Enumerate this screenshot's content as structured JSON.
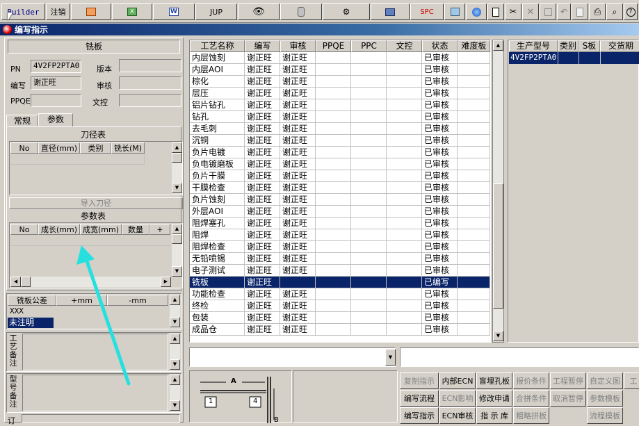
{
  "toolbar": {
    "builder": "Builder",
    "logout": "注销",
    "jup": "JUP",
    "spc": "SPC"
  },
  "window_title": "编写指示",
  "header": {
    "title": "铣板",
    "pn_label": "PN",
    "pn_value": "4V2FP2PTA0",
    "version_label": "版本",
    "version_value": "",
    "writer_label": "编写",
    "writer_value": "谢正旺",
    "review_label": "审核",
    "review_value": "",
    "ppqe_label": "PPQE",
    "ppqe_value": "",
    "doc_label": "文控",
    "doc_value": ""
  },
  "tabs": [
    "常规",
    "参数"
  ],
  "tool_table": {
    "title": "刀径表",
    "columns": [
      "No",
      "直径(mm)",
      "类别",
      "铣长(M)"
    ],
    "import_button": "导入刀径"
  },
  "param_table": {
    "title": "参数表",
    "columns": [
      "No",
      "成长(mm)",
      "成宽(mm)",
      "数量",
      "+"
    ]
  },
  "tolerance": {
    "label": "铣板公差",
    "plus": "+mm",
    "minus": "-mm",
    "value": "XXX",
    "note": "未注明"
  },
  "remarks": {
    "process": "工艺备注",
    "model": "型号备注",
    "bottom": "订"
  },
  "grid": {
    "columns": [
      "工艺名称",
      "编写",
      "审核",
      "PPQE",
      "PPC",
      "文控",
      "状态",
      "难度板"
    ],
    "rows": [
      [
        "内层蚀刻",
        "谢正旺",
        "谢正旺",
        "",
        "",
        "",
        "已审核",
        ""
      ],
      [
        "内层AOI",
        "谢正旺",
        "谢正旺",
        "",
        "",
        "",
        "已审核",
        ""
      ],
      [
        "棕化",
        "谢正旺",
        "谢正旺",
        "",
        "",
        "",
        "已审核",
        ""
      ],
      [
        "层压",
        "谢正旺",
        "谢正旺",
        "",
        "",
        "",
        "已审核",
        ""
      ],
      [
        "铝片钻孔",
        "谢正旺",
        "谢正旺",
        "",
        "",
        "",
        "已审核",
        ""
      ],
      [
        "钻孔",
        "谢正旺",
        "谢正旺",
        "",
        "",
        "",
        "已审核",
        ""
      ],
      [
        "去毛刺",
        "谢正旺",
        "谢正旺",
        "",
        "",
        "",
        "已审核",
        ""
      ],
      [
        "沉铜",
        "谢正旺",
        "谢正旺",
        "",
        "",
        "",
        "已审核",
        ""
      ],
      [
        "负片电镀",
        "谢正旺",
        "谢正旺",
        "",
        "",
        "",
        "已审核",
        ""
      ],
      [
        "负电镀磨板",
        "谢正旺",
        "谢正旺",
        "",
        "",
        "",
        "已审核",
        ""
      ],
      [
        "负片干膜",
        "谢正旺",
        "谢正旺",
        "",
        "",
        "",
        "已审核",
        ""
      ],
      [
        "干膜检查",
        "谢正旺",
        "谢正旺",
        "",
        "",
        "",
        "已审核",
        ""
      ],
      [
        "负片蚀刻",
        "谢正旺",
        "谢正旺",
        "",
        "",
        "",
        "已审核",
        ""
      ],
      [
        "外层AOI",
        "谢正旺",
        "谢正旺",
        "",
        "",
        "",
        "已审核",
        ""
      ],
      [
        "阻焊塞孔",
        "谢正旺",
        "谢正旺",
        "",
        "",
        "",
        "已审核",
        ""
      ],
      [
        "阻焊",
        "谢正旺",
        "谢正旺",
        "",
        "",
        "",
        "已审核",
        ""
      ],
      [
        "阻焊检查",
        "谢正旺",
        "谢正旺",
        "",
        "",
        "",
        "已审核",
        ""
      ],
      [
        "无铅喷锡",
        "谢正旺",
        "谢正旺",
        "",
        "",
        "",
        "已审核",
        ""
      ],
      [
        "电子测试",
        "谢正旺",
        "谢正旺",
        "",
        "",
        "",
        "已审核",
        ""
      ],
      [
        "铣板",
        "谢正旺",
        "",
        "",
        "",
        "",
        "已编写",
        ""
      ],
      [
        "功能检查",
        "谢正旺",
        "谢正旺",
        "",
        "",
        "",
        "已审核",
        ""
      ],
      [
        "终检",
        "谢正旺",
        "谢正旺",
        "",
        "",
        "",
        "已审核",
        ""
      ],
      [
        "包装",
        "谢正旺",
        "谢正旺",
        "",
        "",
        "",
        "已审核",
        ""
      ],
      [
        "成品仓",
        "谢正旺",
        "谢正旺",
        "",
        "",
        "",
        "已审核",
        ""
      ]
    ],
    "selected_index": 19
  },
  "right_table": {
    "columns": [
      "生产型号",
      "类别",
      "S板",
      "交货期"
    ],
    "rows": [
      [
        "4V2FP2PTA0",
        "",
        "",
        ""
      ]
    ]
  },
  "diagram": {
    "label_a": "A",
    "label_1": "1",
    "label_4": "4",
    "label_b": "B"
  },
  "buttons": [
    [
      "复制指示",
      "内部ECN",
      "盲埋孔板",
      "报价条件",
      "工程暂停",
      "自定义图",
      "工"
    ],
    [
      "编写流程",
      "ECN影响",
      "修改申请",
      "合拼条件",
      "取消暂停",
      "参数模板",
      ""
    ],
    [
      "编写指示",
      "ECN审核",
      "指 示 库",
      "粗略拼板",
      "",
      "流程模板",
      ""
    ]
  ],
  "buttons_disabled": [
    [
      true,
      false,
      false,
      true,
      true,
      true,
      true
    ],
    [
      false,
      true,
      false,
      true,
      true,
      true,
      false
    ],
    [
      false,
      false,
      false,
      true,
      false,
      true,
      false
    ]
  ]
}
